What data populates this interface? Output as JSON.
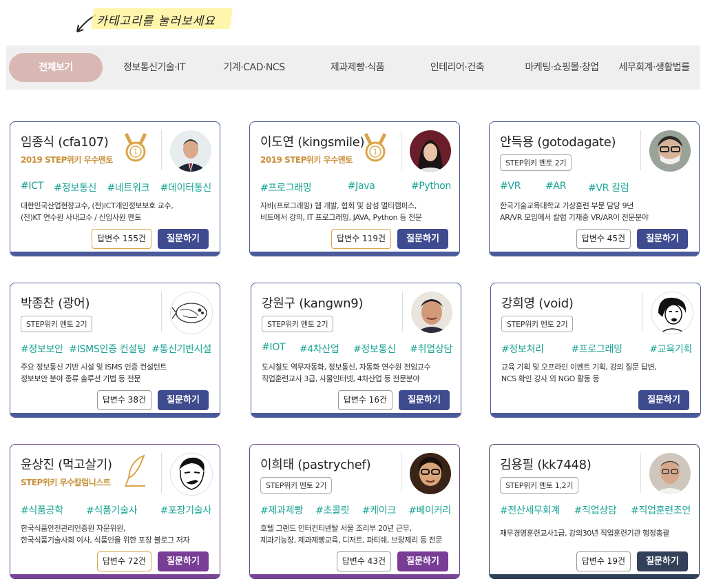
{
  "hint": {
    "text": "카테고리를 눌러보세요"
  },
  "tabs": [
    {
      "label": "전체보기",
      "active": true
    },
    {
      "label": "정보통신기술·IT"
    },
    {
      "label": "기계·CAD·NCS"
    },
    {
      "label": "제과제빵·식품"
    },
    {
      "label": "인테리어·건축"
    },
    {
      "label": "마케팅·쇼핑몰·창업"
    },
    {
      "label": "세무회계·생활법률"
    }
  ],
  "colors": {
    "accent": "#3f4b8f",
    "tag": "#1aa394",
    "award": "#c9913a",
    "active_tab": "#d9b8b3",
    "purple": "#7a3d96",
    "dark": "#33405a"
  },
  "cards": [
    {
      "name": "임종식 (cfa107)",
      "award": "2019 STEP위키 우수멘토",
      "badge_icon": "gold-medal-icon",
      "avatar": "portrait-man-suit-icon",
      "tags": [
        "#ICT",
        "#정보통신",
        "#네트워크",
        "#데이터통신"
      ],
      "desc": [
        "대한민국산업현장교수, (전)ICT개인정보보호 교수,",
        "(전)KT 연수원 사내교수 / 신입사원 멘토"
      ],
      "answers": "답변수 155건",
      "ask": "질문하기"
    },
    {
      "name": "이도연 (kingsmile)",
      "award": "2019 STEP위키 우수멘토",
      "badge_icon": "gold-medal-icon",
      "avatar": "portrait-woman-icon",
      "tags": [
        "#프로그래밍",
        "#Java",
        "#Python"
      ],
      "desc": [
        "자바(프로그래밍) 웹 개발, 협회 및 삼성 멀티캠퍼스,",
        "비트에서 강의, IT 프로그래밍, JAVA, Python 등 전문"
      ],
      "answers": "답변수 119건",
      "ask": "질문하기"
    },
    {
      "name": "안득용 (gotodagate)",
      "gen": "STEP위키 멘토 2기",
      "avatar": "portrait-man-mask-icon",
      "tags": [
        "#VR",
        "#AR",
        "#VR 칼럼"
      ],
      "desc": [
        "한국기술교육대학교 가상훈련 부문 담당 9년",
        "AR/VR 모임에서 칼럼 기재중 VR/AR이 전문분야"
      ],
      "answers": "답변수 45건",
      "ask": "질문하기"
    },
    {
      "name": "박종찬 (광어)",
      "gen": "STEP위키 멘토 2기",
      "avatar": "flatfish-drawing-icon",
      "tags": [
        "#정보보안",
        "#ISMS인증 컨설팅",
        "#통신기반시설"
      ],
      "desc": [
        "주요 정보통신 기반 시설 및 ISMS 인증 컨설턴트",
        "정보보안 분야 종류 솔루션 기법 등 전문"
      ],
      "answers": "답변수 38건",
      "ask": "질문하기"
    },
    {
      "name": "강원구 (kangwn9)",
      "gen": "STEP위키 멘토 2기",
      "avatar": "portrait-man-icon",
      "tags": [
        "#IOT",
        "#4차산업",
        "#정보통신",
        "#취업상담"
      ],
      "desc": [
        "도시철도 역무자동화, 정보통신, 자동화 연수원 전임교수",
        "직업훈련교사 3급, 사물인터넷, 4차산업 등 전문분야"
      ],
      "answers": "답변수 16건",
      "ask": "질문하기"
    },
    {
      "name": "강희영 (void)",
      "gen": "STEP위키 멘토 2기",
      "avatar": "comic-woman-icon",
      "tags": [
        "#정보처리",
        "#프로그래밍",
        "#교육기획"
      ],
      "desc": [
        "교육 기획 및 오프라인 이벤트 기획, 강의 질문 답변,",
        "NCS 확인 강사 외 NGO 활동 등"
      ],
      "answers": "",
      "ask": "질문하기"
    },
    {
      "name": "윤상진 (먹고살기)",
      "award": "STEP위키 우수칼럼니스트",
      "badge_icon": "quill-pen-icon",
      "avatar": "comic-man-icon",
      "tags": [
        "#식품공학",
        "#식품기술사",
        "#포장기술사"
      ],
      "desc": [
        "한국식품안전관리인증원 자문위원,",
        "한국식품기술사회 이사, 식품인을 위한 포장 블로그 저자"
      ],
      "answers": "답변수 72건",
      "ask": "질문하기"
    },
    {
      "name": "이희태 (pastrychef)",
      "gen": "STEP위키 멘토 2기",
      "avatar": "portrait-chef-icon",
      "tags": [
        "#제과제빵",
        "#초콜릿",
        "#케이크",
        "#베이커리"
      ],
      "desc": [
        "호텔 그랜드 인터컨티넨탈 서울 조리부  20년 근무,",
        "제과기능장, 제과제빵교육, 디저트, 파티쉐, 브랑제리 등 전문"
      ],
      "answers": "답변수 43건",
      "ask": "질문하기"
    },
    {
      "name": "김용필 (kk7448)",
      "gen": "STEP위키 멘토 1,2기",
      "avatar": "portrait-man-glasses-icon",
      "tags": [
        "#전산세무회계",
        "#직업상담",
        "#직업훈련조언"
      ],
      "desc": [
        "재무경영훈련교사1급, 강의30년 직업훈련기관 행정총괄"
      ],
      "answers": "답변수 19건",
      "ask": "질문하기"
    }
  ]
}
